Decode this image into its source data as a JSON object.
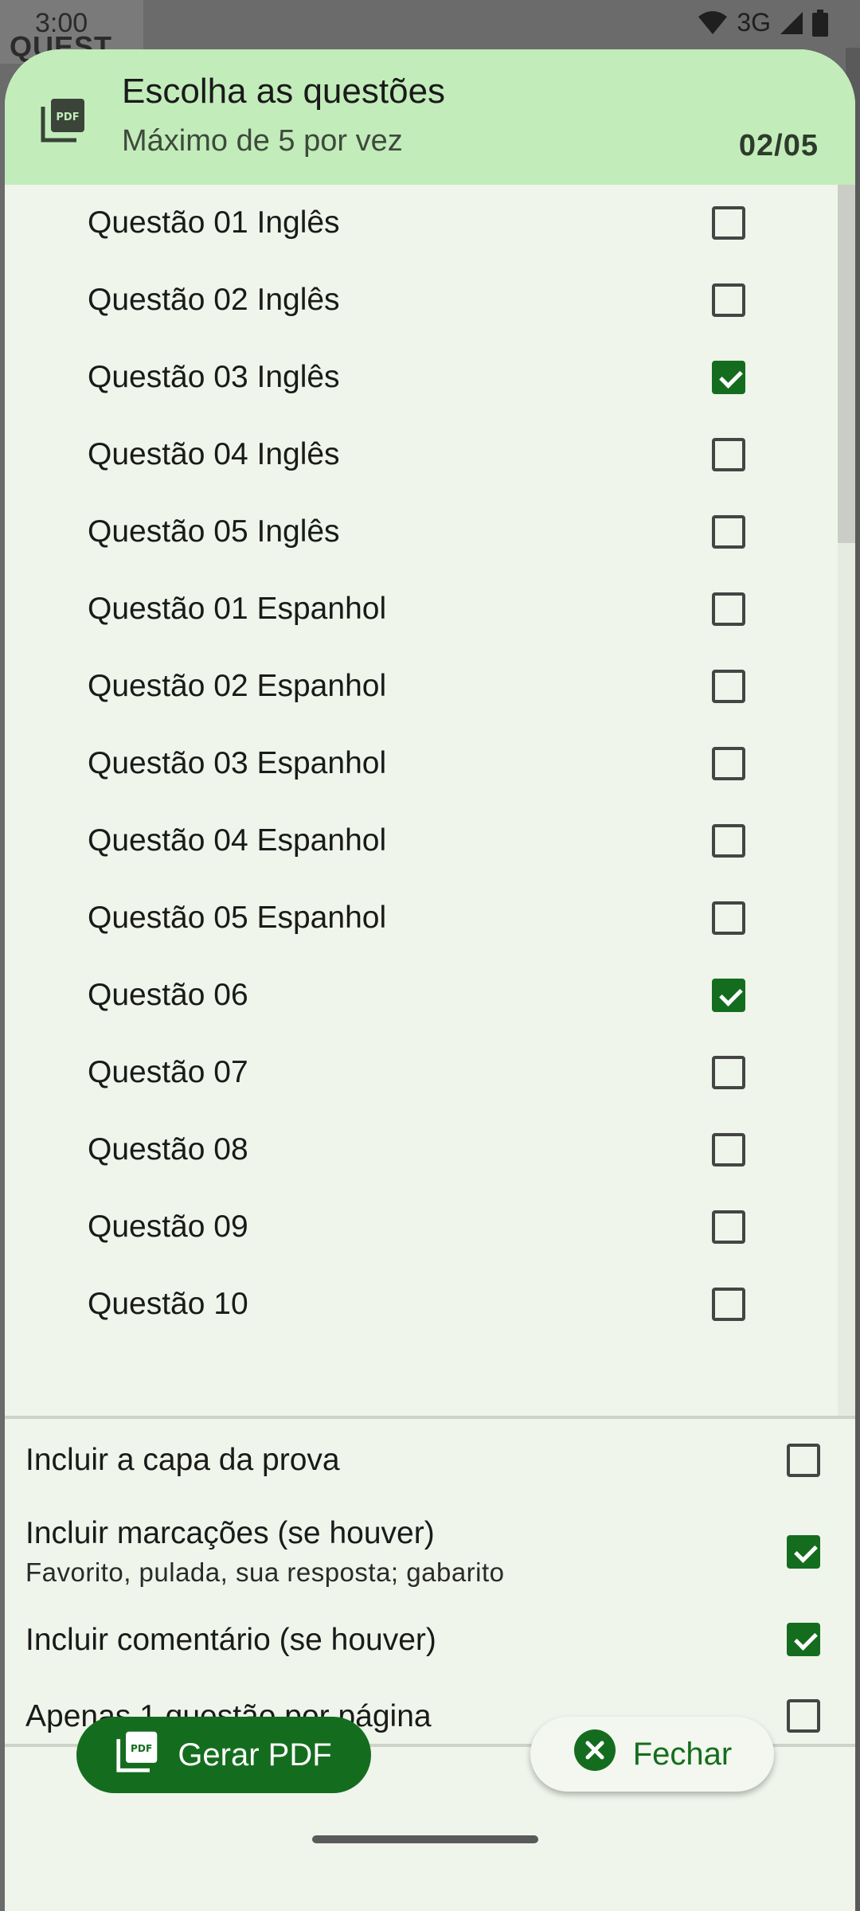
{
  "status_bar": {
    "time": "3:00",
    "network": "3G"
  },
  "background_app": {
    "title_fragment": "QUEST"
  },
  "sheet": {
    "title": "Escolha as questões",
    "subtitle": "Máximo de 5 por vez",
    "counter": "02/05",
    "header_icon": "pdf-icon"
  },
  "questions": [
    {
      "label": "Questão 01 Inglês",
      "checked": false
    },
    {
      "label": "Questão 02 Inglês",
      "checked": false
    },
    {
      "label": "Questão 03 Inglês",
      "checked": true
    },
    {
      "label": "Questão 04 Inglês",
      "checked": false
    },
    {
      "label": "Questão 05 Inglês",
      "checked": false
    },
    {
      "label": "Questão 01 Espanhol",
      "checked": false
    },
    {
      "label": "Questão 02 Espanhol",
      "checked": false
    },
    {
      "label": "Questão 03 Espanhol",
      "checked": false
    },
    {
      "label": "Questão 04 Espanhol",
      "checked": false
    },
    {
      "label": "Questão 05 Espanhol",
      "checked": false
    },
    {
      "label": "Questão 06",
      "checked": true
    },
    {
      "label": "Questão 07",
      "checked": false
    },
    {
      "label": "Questão 08",
      "checked": false
    },
    {
      "label": "Questão 09",
      "checked": false
    },
    {
      "label": "Questão 10",
      "checked": false
    }
  ],
  "options": {
    "cover": {
      "label": "Incluir a capa da prova",
      "checked": false
    },
    "marks": {
      "label": "Incluir marcações (se houver)",
      "sublabel": "Favorito, pulada, sua resposta; gabarito",
      "checked": true
    },
    "comments": {
      "label": "Incluir comentário (se houver)",
      "checked": true
    },
    "one_per_page": {
      "label": "Apenas 1 questão por página",
      "checked": false
    }
  },
  "actions": {
    "generate_label": "Gerar PDF",
    "close_label": "Fechar"
  },
  "colors": {
    "accent": "#146d1e",
    "header_bg": "#c3ecbb",
    "sheet_bg": "#eff5ea"
  }
}
